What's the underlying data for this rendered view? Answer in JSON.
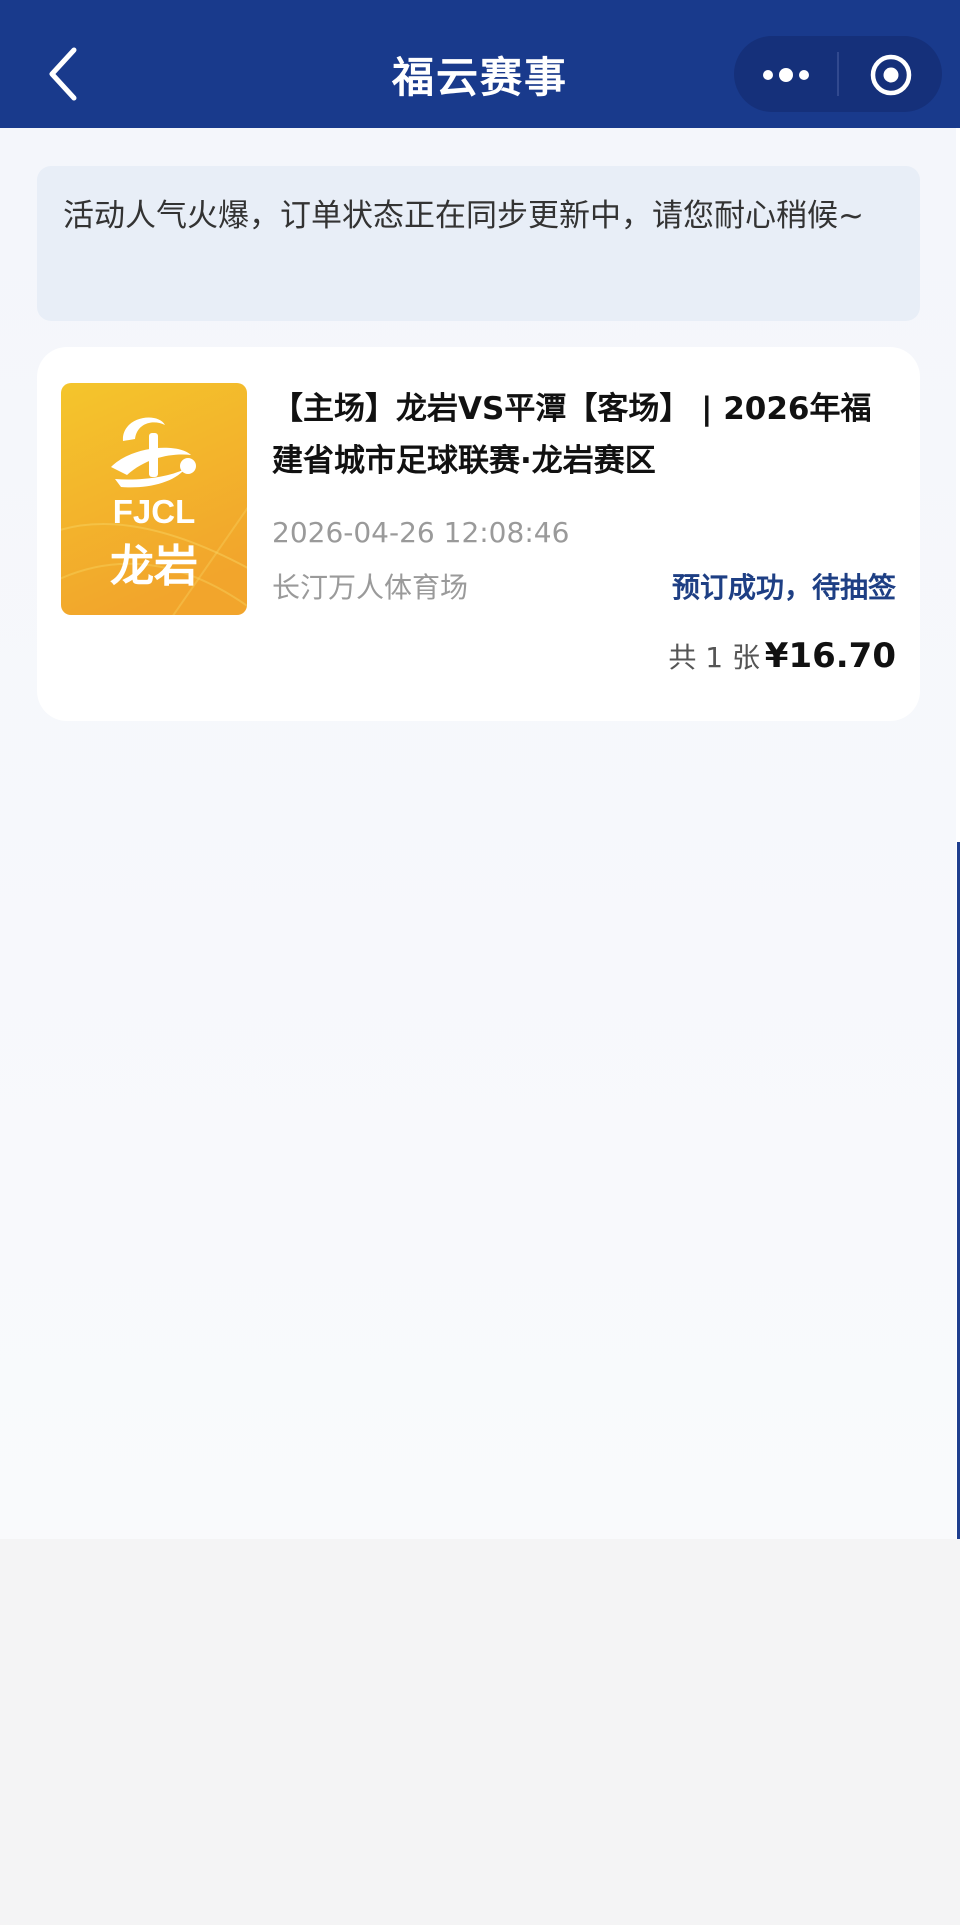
{
  "header": {
    "title": "福云赛事",
    "back_icon": "chevron-left-icon",
    "more_icon": "more-dots-icon",
    "close_icon": "target-circle-icon",
    "bg_color": "#193a8c"
  },
  "notice": {
    "text": "活动人气火爆，订单状态正在同步更新中，请您耐心稍候~"
  },
  "order": {
    "logo": {
      "brand": "FJCL",
      "city": "龙岩"
    },
    "title": "【主场】龙岩VS平潭【客场】 | 2026年福建省城市足球联赛·龙岩赛区",
    "datetime": "2026-04-26 12:08:46",
    "venue": "长汀万人体育场",
    "status": "预订成功，待抽签",
    "status_color": "#1e3f84",
    "quantity": "共 1 张",
    "price": "¥16.70"
  }
}
